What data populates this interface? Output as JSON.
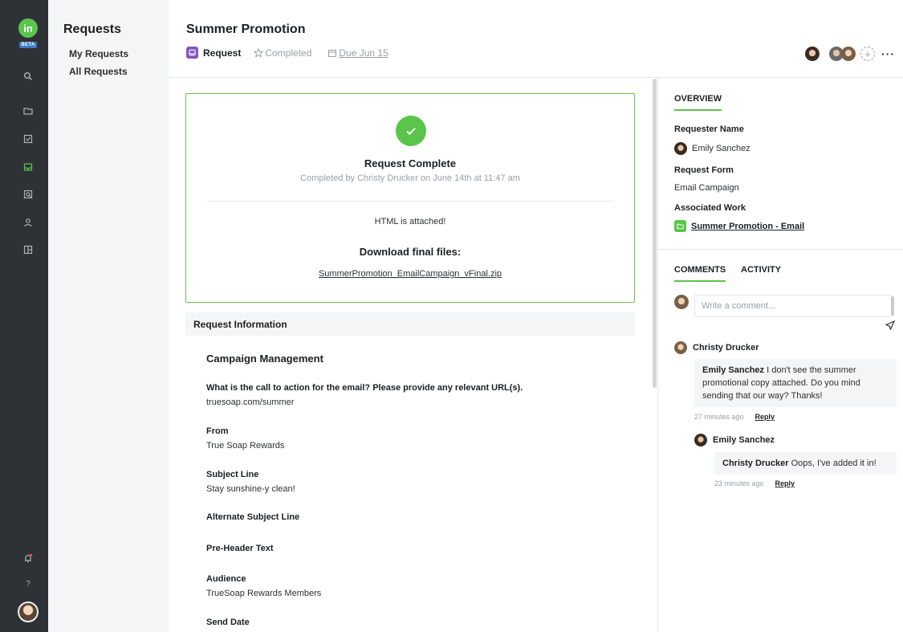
{
  "rail": {
    "logo_text": "in",
    "badge_text": "BETA",
    "icons": [
      "search-icon",
      "folder-icon",
      "tasks-icon",
      "inbox-icon",
      "review-icon",
      "people-icon",
      "board-icon",
      "notification-icon",
      "help-icon"
    ]
  },
  "subnav": {
    "title": "Requests",
    "items": [
      {
        "label": "My Requests"
      },
      {
        "label": "All Requests"
      }
    ]
  },
  "header": {
    "title": "Summer Promotion",
    "type_label": "Request",
    "status_label": "Completed",
    "due_label": "Due Jun 15",
    "more_label": "···"
  },
  "complete_card": {
    "title": "Request Complete",
    "subtitle": "Completed by Christy Drucker on June 14th at 11:47 am",
    "note": "HTML is attached!",
    "download_title": "Download final files:",
    "file_name": "SummerPromotion_EmailCampaign_vFinal.zip"
  },
  "request_info": {
    "bar_label": "Request Information",
    "section_title": "Campaign Management",
    "fields": [
      {
        "question": "What is the call to action for the email? Please provide any relevant URL(s).",
        "answer": "truesoap.com/summer"
      },
      {
        "question": "From",
        "answer": "True Soap Rewards"
      },
      {
        "question": "Subject Line",
        "answer": "Stay sunshine-y clean!"
      },
      {
        "question": "Alternate Subject Line",
        "answer": ""
      },
      {
        "question": "Pre-Header Text",
        "answer": ""
      },
      {
        "question": "Audience",
        "answer": "TrueSoap Rewards Members"
      },
      {
        "question": "Send Date",
        "answer": ""
      }
    ]
  },
  "overview": {
    "tab_label": "OVERVIEW",
    "requester_label": "Requester Name",
    "requester_name": "Emily Sanchez",
    "form_label": "Request Form",
    "form_value": "Email Campaign",
    "work_label": "Associated Work",
    "work_value": "Summer Promotion - Email"
  },
  "comments": {
    "tab_comments": "COMMENTS",
    "tab_activity": "ACTIVITY",
    "input_placeholder": "Write a comment...",
    "thread": [
      {
        "author": "Christy Drucker",
        "mention": "Emily Sanchez",
        "text": " I don't see the summer promotional copy attached. Do you mind sending that our way? Thanks!",
        "time": "27 minutes ago",
        "reply_label": "Reply"
      },
      {
        "author": "Emily Sanchez",
        "mention": "Christy Drucker",
        "text": " Oops, I've added it in!",
        "time": "23 minutes ago",
        "reply_label": "Reply"
      }
    ]
  },
  "colors": {
    "rail_bg": "#2e3236",
    "accent_green": "#5ac54a",
    "request_purple": "#7e57c2",
    "beta_blue": "#3b7cc2"
  }
}
